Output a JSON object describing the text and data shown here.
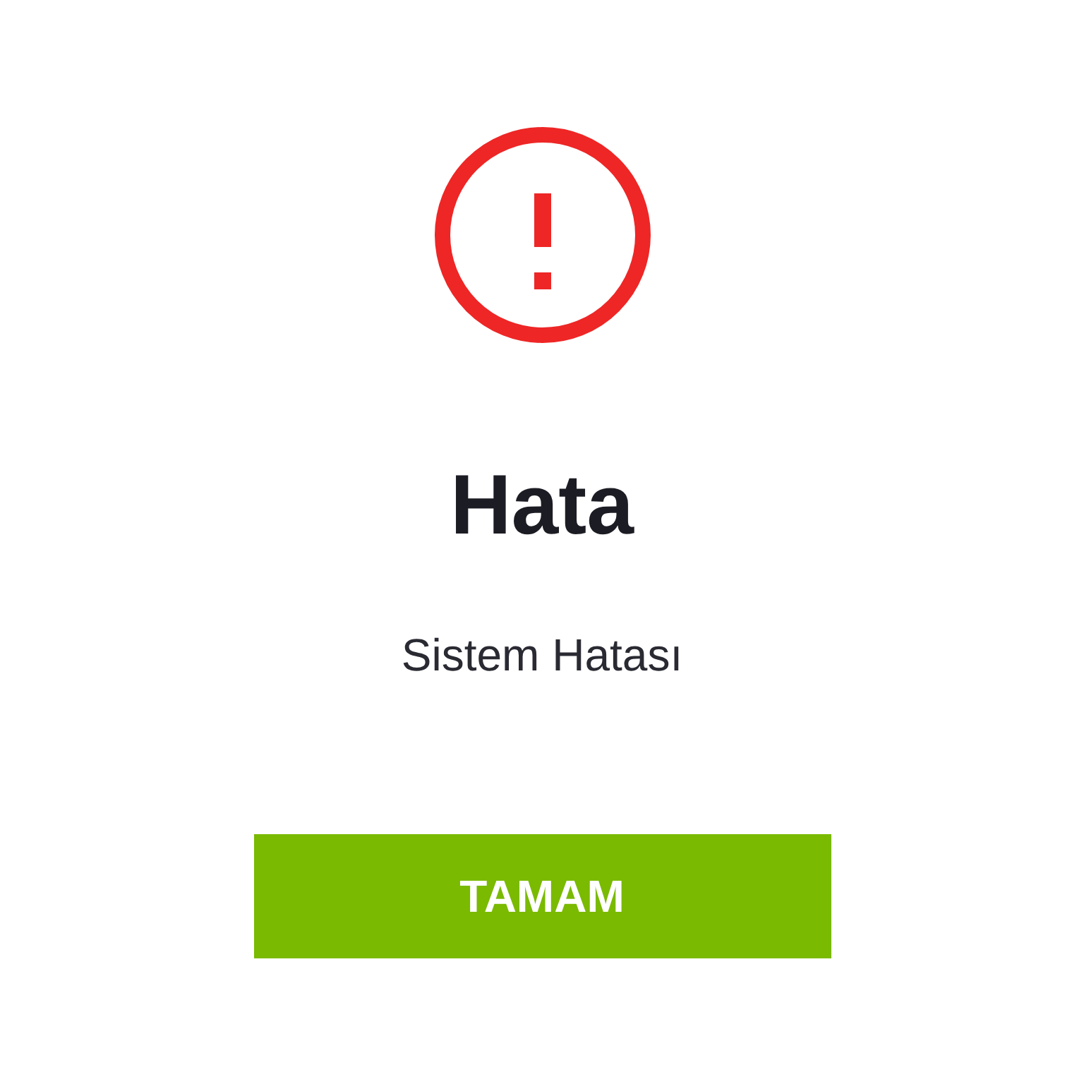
{
  "dialog": {
    "kind": "error",
    "title": "Hata",
    "message": "Sistem Hatası",
    "buttons": [
      "TAMAM"
    ]
  }
}
